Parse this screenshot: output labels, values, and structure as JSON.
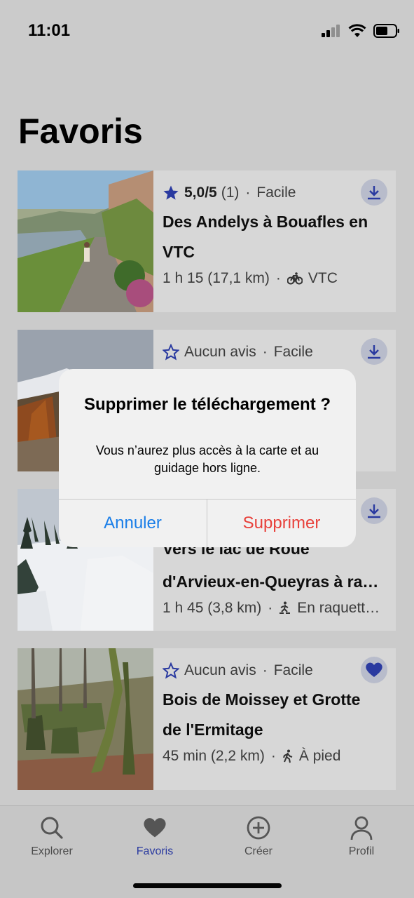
{
  "status_bar": {
    "time": "11:01"
  },
  "page": {
    "title": "Favoris"
  },
  "cards": [
    {
      "rating": "5,0/5",
      "review_count": "(1)",
      "difficulty": "Facile",
      "title": "Des Andelys à Bouafles en VTC",
      "duration": "1 h 15 (17,1 km)",
      "activity": "VTC",
      "activity_icon": "bike-icon",
      "action_icon": "download-icon",
      "star_filled": true
    },
    {
      "rating": "Aucun avis",
      "difficulty": "Facile",
      "title": "",
      "duration": "",
      "activity": "",
      "action_icon": "download-icon",
      "star_filled": false
    },
    {
      "rating": "",
      "difficulty": "",
      "title_line1": "Vers le lac de Roue",
      "title_line2": "d'Arvieux-en-Queyras à ra…",
      "duration": "1 h 45 (3,8 km)",
      "activity": "En raquett…",
      "activity_icon": "snowshoe-icon",
      "action_icon": "download-icon"
    },
    {
      "rating": "Aucun avis",
      "difficulty": "Facile",
      "title": "Bois de Moissey et Grotte de l'Ermitage",
      "duration": "45 min (2,2 km)",
      "activity": "À pied",
      "activity_icon": "walking-icon",
      "action_icon": "heart-icon",
      "star_filled": false
    }
  ],
  "separator": "·",
  "tabs": [
    {
      "label": "Explorer",
      "icon": "search-icon",
      "active": false
    },
    {
      "label": "Favoris",
      "icon": "heart-icon",
      "active": true
    },
    {
      "label": "Créer",
      "icon": "plus-circle-icon",
      "active": false
    },
    {
      "label": "Profil",
      "icon": "person-icon",
      "active": false
    }
  ],
  "alert": {
    "title": "Supprimer le téléchargement ?",
    "message": "Vous n’aurez plus accès à la carte et au guidage hors ligne.",
    "cancel_label": "Annuler",
    "confirm_label": "Supprimer"
  },
  "colors": {
    "accent": "#2a3aa0",
    "alert_cancel": "#1a7ee8",
    "alert_destructive": "#e8413b",
    "dimmed_background": "#cbcbcb"
  }
}
